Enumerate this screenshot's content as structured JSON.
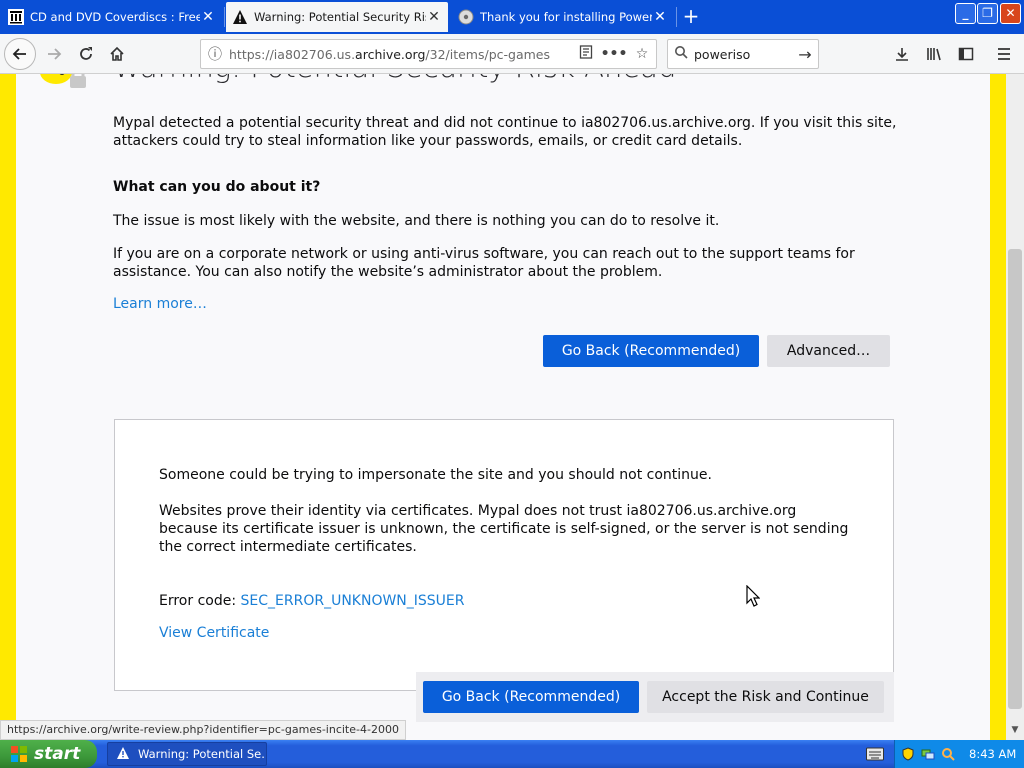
{
  "browser": {
    "tabs": [
      {
        "label": "CD and DVD Coverdiscs : Free Te",
        "icon": "archive-icon",
        "active": false
      },
      {
        "label": "Warning: Potential Security Risk A",
        "icon": "warning-triangle-icon",
        "active": true
      },
      {
        "label": "Thank you for installing PowerISO!",
        "icon": "poweriso-disc-icon",
        "active": false
      }
    ],
    "new_tab_label": "+",
    "window_controls": {
      "minimize": "_",
      "maximize": "❐",
      "close": "✕"
    }
  },
  "nav": {
    "url_prefix": "https://ia802706.us.",
    "url_domain": "archive.org",
    "url_suffix": "/32/items/pc-games",
    "search_value": "poweriso",
    "search_placeholder": "Search"
  },
  "page": {
    "heading": "Warning: Potential Security Risk Ahead",
    "intro": "Mypal detected a potential security threat and did not continue to ia802706.us.archive.org. If you visit this site, attackers could try to steal information like your passwords, emails, or credit card details.",
    "subheading": "What can you do about it?",
    "p1": "The issue is most likely with the website, and there is nothing you can do to resolve it.",
    "p2": "If you are on a corporate network or using anti-virus software, you can reach out to the support teams for assistance. You can also notify the website’s administrator about the problem.",
    "learn_more": "Learn more…",
    "go_back_label": "Go Back (Recommended)",
    "advanced_label": "Advanced…",
    "advanced": {
      "p1": "Someone could be trying to impersonate the site and you should not continue.",
      "p2": "Websites prove their identity via certificates. Mypal does not trust ia802706.us.archive.org because its certificate issuer is unknown, the certificate is self-signed, or the server is not sending the correct intermediate certificates.",
      "error_prefix": "Error code: ",
      "error_code": "SEC_ERROR_UNKNOWN_ISSUER",
      "view_certificate": "View Certificate",
      "go_back_label": "Go Back (Recommended)",
      "accept_label": "Accept the Risk and Continue"
    },
    "status_url": "https://archive.org/write-review.php?identifier=pc-games-incite-4-2000"
  },
  "taskbar": {
    "start_label": "start",
    "task_label": "Warning: Potential Se...",
    "clock": "8:43 AM"
  },
  "colors": {
    "accent_blue": "#0a5fd9",
    "warning_yellow": "#ffe900",
    "link_blue": "#1a7fd6"
  }
}
